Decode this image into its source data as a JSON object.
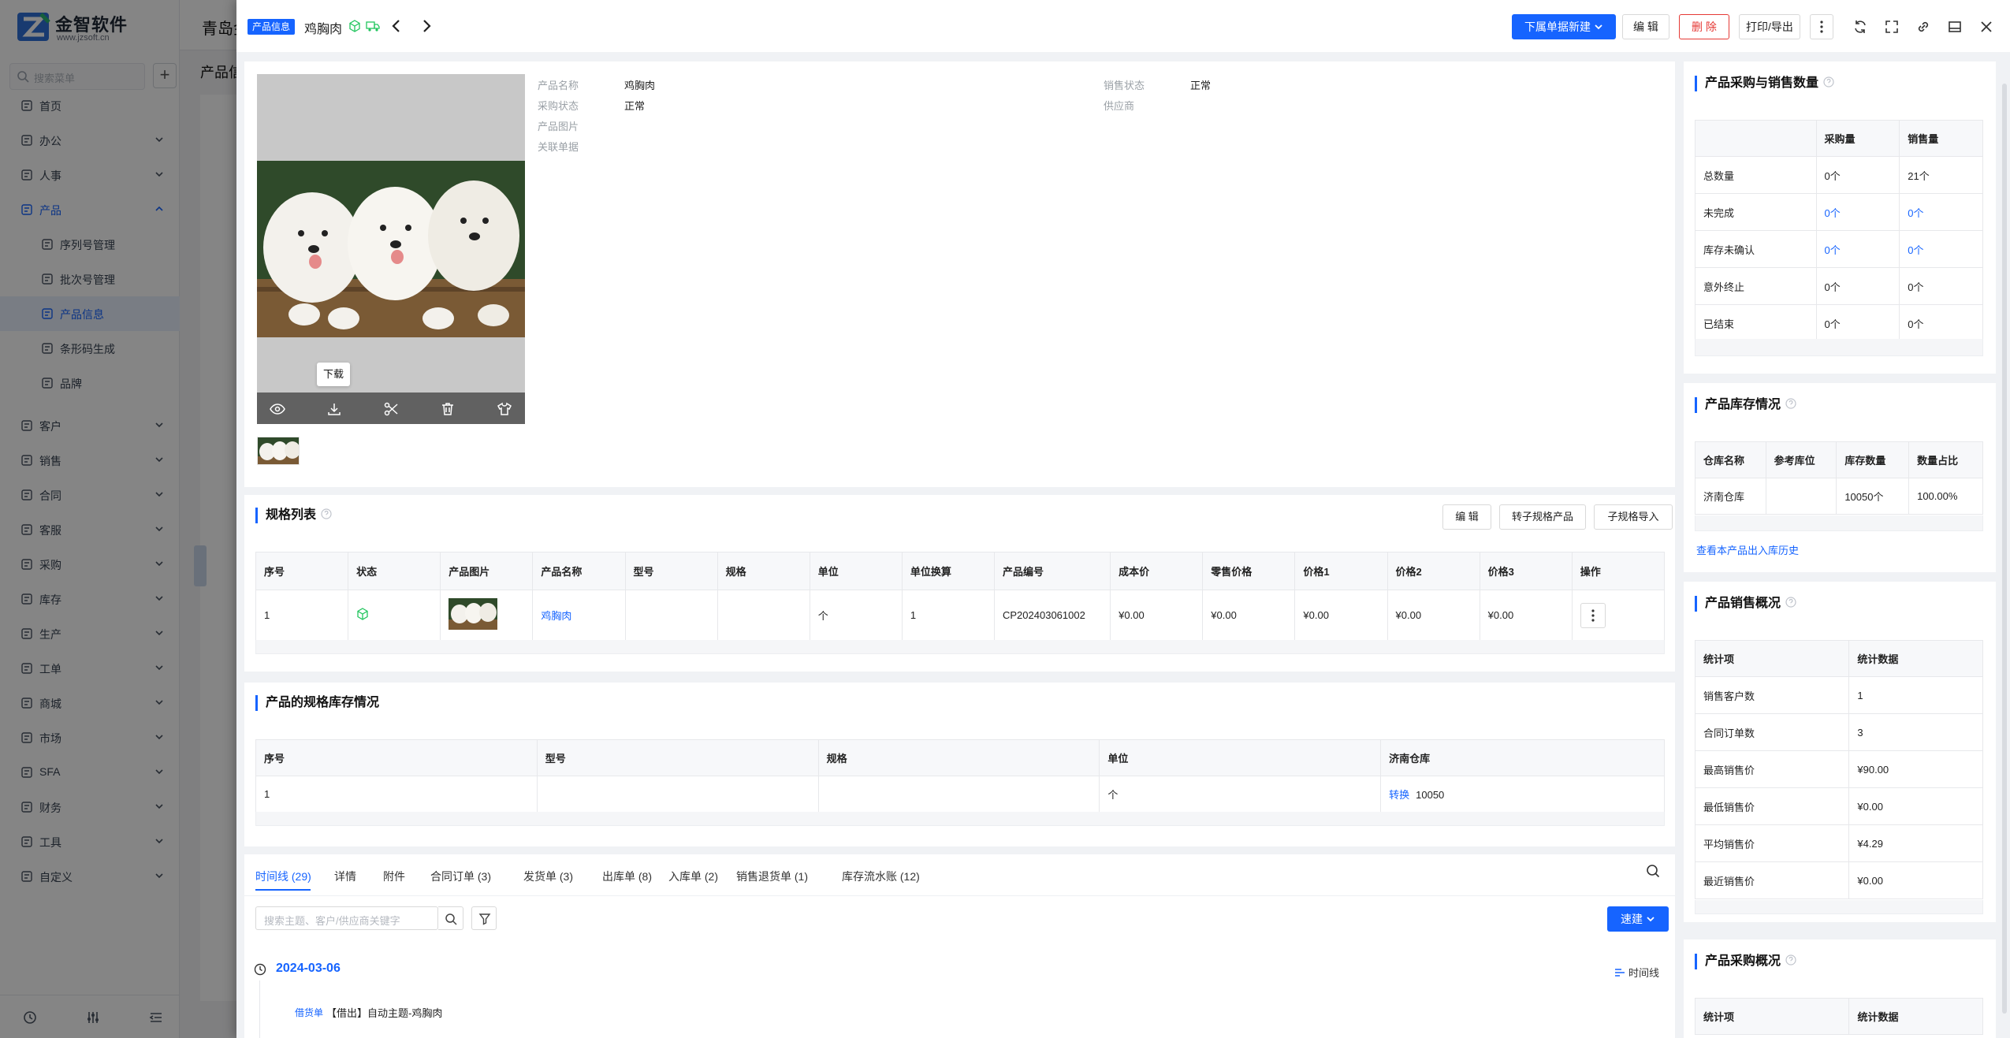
{
  "app": {
    "brand_name": "金智软件",
    "brand_url": "www.jzsoft.cn",
    "header_title": "青岛金",
    "page_title": "产品信",
    "search_placeholder": "搜索菜单"
  },
  "sidebar": {
    "items": [
      {
        "label": "首页",
        "icon": "home-icon"
      },
      {
        "label": "办公",
        "icon": "office-icon"
      },
      {
        "label": "人事",
        "icon": "person-icon"
      },
      {
        "label": "产品",
        "icon": "cube-icon"
      },
      {
        "label": "序列号管理",
        "icon": "doc-icon"
      },
      {
        "label": "批次号管理",
        "icon": "doc-icon"
      },
      {
        "label": "产品信息",
        "icon": "doc-icon"
      },
      {
        "label": "条形码生成",
        "icon": "barcode-icon"
      },
      {
        "label": "品牌",
        "icon": "doc-icon"
      },
      {
        "label": "客户",
        "icon": "customer-icon"
      },
      {
        "label": "销售",
        "icon": "sales-icon"
      },
      {
        "label": "合同",
        "icon": "contract-icon"
      },
      {
        "label": "客服",
        "icon": "service-icon"
      },
      {
        "label": "采购",
        "icon": "cart-icon"
      },
      {
        "label": "库存",
        "icon": "warehouse-icon"
      },
      {
        "label": "生产",
        "icon": "production-icon"
      },
      {
        "label": "工单",
        "icon": "ticket-icon"
      },
      {
        "label": "商城",
        "icon": "shop-icon"
      },
      {
        "label": "市场",
        "icon": "market-icon"
      },
      {
        "label": "SFA",
        "icon": "sfa-icon"
      },
      {
        "label": "财务",
        "icon": "finance-icon"
      },
      {
        "label": "工具",
        "icon": "tool-icon"
      },
      {
        "label": "自定义",
        "icon": "grid-icon"
      }
    ]
  },
  "drawer": {
    "tag": "产品信息",
    "product_name": "鸡胸肉",
    "buttons": {
      "new_doc": "下属单据新建",
      "edit": "编 辑",
      "delete": "删 除",
      "print": "打印/导出"
    }
  },
  "info": {
    "fields_left": [
      {
        "label": "产品名称",
        "value": "鸡胸肉"
      },
      {
        "label": "采购状态",
        "value": "正常"
      },
      {
        "label": "产品图片",
        "value": ""
      },
      {
        "label": "关联单据",
        "value": ""
      }
    ],
    "fields_right": [
      {
        "label": "销售状态",
        "value": "正常"
      },
      {
        "label": "供应商",
        "value": ""
      }
    ],
    "image_tooltip": "下载"
  },
  "spec_list": {
    "title": "规格列表",
    "buttons": [
      "编 辑",
      "转子规格产品",
      "子规格导入"
    ],
    "columns": [
      "序号",
      "状态",
      "产品图片",
      "产品名称",
      "型号",
      "规格",
      "单位",
      "单位换算",
      "产品编号",
      "成本价",
      "零售价格",
      "价格1",
      "价格2",
      "价格3",
      "操作"
    ],
    "rows": [
      {
        "seq": "1",
        "name": "鸡胸肉",
        "model": "",
        "spec": "",
        "unit": "个",
        "conversion": "1",
        "code": "CP202403061002",
        "cost": "¥0.00",
        "retail": "¥0.00",
        "price1": "¥0.00",
        "price2": "¥0.00",
        "price3": "¥0.00"
      }
    ]
  },
  "spec_stock": {
    "title": "产品的规格库存情况",
    "columns": [
      "序号",
      "型号",
      "规格",
      "单位",
      "济南仓库"
    ],
    "rows": [
      {
        "seq": "1",
        "model": "",
        "spec": "",
        "unit": "个",
        "link": "转换",
        "qty": "10050"
      }
    ]
  },
  "timeline": {
    "tabs": [
      "时间线 (29)",
      "详情",
      "附件",
      "合同订单 (3)",
      "发货单 (3)",
      "出库单 (8)",
      "入库单 (2)",
      "销售退货单 (1)",
      "库存流水账 (12)"
    ],
    "search_placeholder": "搜索主题、客户/供应商关键字",
    "quick_label": "速建",
    "view_label": "时间线",
    "date": "2024-03-06",
    "entry_type": "借货单",
    "entry_text": "【借出】自动主题-鸡胸肉"
  },
  "purchase_sales": {
    "title": "产品采购与销售数量",
    "columns": [
      "",
      "采购量",
      "销售量"
    ],
    "rows": [
      {
        "label": "总数量",
        "purchase": "0个",
        "sales": "21个",
        "link": false
      },
      {
        "label": "未完成",
        "purchase": "0个",
        "sales": "0个",
        "link": true
      },
      {
        "label": "库存未确认",
        "purchase": "0个",
        "sales": "0个",
        "link": true
      },
      {
        "label": "意外终止",
        "purchase": "0个",
        "sales": "0个",
        "link": false
      },
      {
        "label": "已结束",
        "purchase": "0个",
        "sales": "0个",
        "link": false
      }
    ]
  },
  "stock": {
    "title": "产品库存情况",
    "columns": [
      "仓库名称",
      "参考库位",
      "库存数量",
      "数量占比"
    ],
    "rows": [
      {
        "warehouse": "济南仓库",
        "location": "",
        "qty": "10050个",
        "ratio": "100.00%"
      }
    ],
    "history_link": "查看本产品出入库历史"
  },
  "sales_overview": {
    "title": "产品销售概况",
    "columns": [
      "统计项",
      "统计数据"
    ],
    "rows": [
      {
        "label": "销售客户数",
        "value": "1"
      },
      {
        "label": "合同订单数",
        "value": "3"
      },
      {
        "label": "最高销售价",
        "value": "¥90.00"
      },
      {
        "label": "最低销售价",
        "value": "¥0.00"
      },
      {
        "label": "平均销售价",
        "value": "¥4.29"
      },
      {
        "label": "最近销售价",
        "value": "¥0.00"
      }
    ]
  },
  "purchase_overview": {
    "title": "产品采购概况",
    "columns": [
      "统计项",
      "统计数据"
    ]
  },
  "colors": {
    "primary": "#1664ff",
    "danger": "#e53935",
    "success": "#22c55e"
  }
}
